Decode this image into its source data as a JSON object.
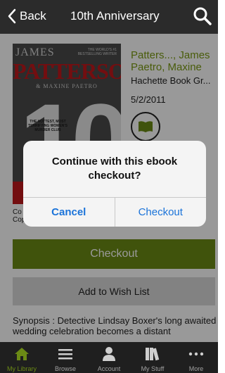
{
  "nav": {
    "back_label": "Back",
    "title": "10th Anniversary"
  },
  "book": {
    "cover": {
      "author_first": "JAMES",
      "author_last": "PATTERSON",
      "badge": "THE WORLD'S #1 BESTSELLING WRITER",
      "coauthor": "& MAXINE PAETRO",
      "big_number": "10",
      "tagline": "THE HOTTEST, MOST TERRIFYING WOMEN'S MURDER CLUB"
    },
    "authors": "Patters..., James Paetro, Maxine",
    "publisher": "Hachette Book Gr...",
    "date": "5/2/2011",
    "format_icon": "book-icon",
    "copies_line1": "Co",
    "copies_line2": "Cop",
    "synopsis": "Synopsis : Detective Lindsay Boxer's long awaited wedding celebration becomes a distant"
  },
  "actions": {
    "checkout_label": "Checkout",
    "wishlist_label": "Add to Wish List"
  },
  "dialog": {
    "message": "Continue with this ebook checkout?",
    "cancel_label": "Cancel",
    "confirm_label": "Checkout"
  },
  "tabs": [
    {
      "label": "My Library",
      "icon": "home-icon",
      "active": true
    },
    {
      "label": "Browse",
      "icon": "list-icon",
      "active": false
    },
    {
      "label": "Account",
      "icon": "person-icon",
      "active": false
    },
    {
      "label": "My Stuff",
      "icon": "books-icon",
      "active": false
    },
    {
      "label": "More",
      "icon": "more-icon",
      "active": false
    }
  ],
  "colors": {
    "accent_green": "#6b8a15",
    "link_blue": "#1a73d9",
    "navbar": "#2b2b2b",
    "tabbar": "#1f1f1f"
  }
}
